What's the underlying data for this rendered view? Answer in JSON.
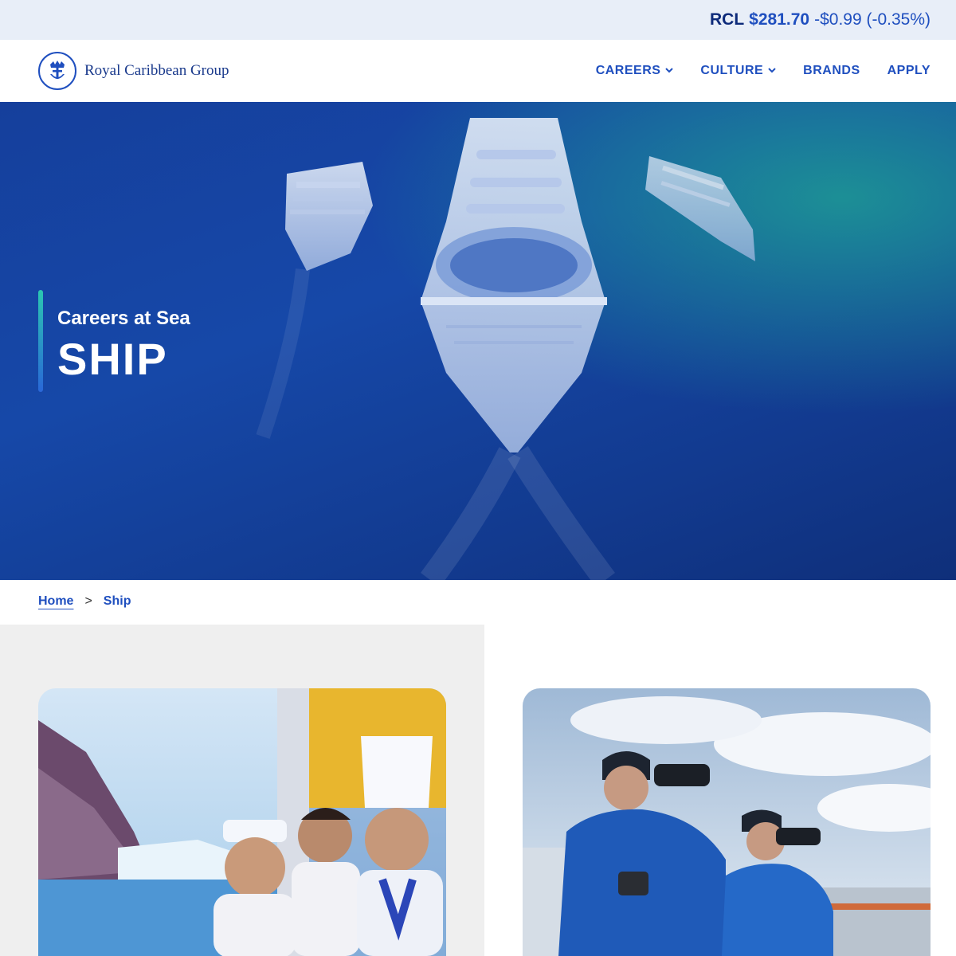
{
  "stock": {
    "symbol": "RCL",
    "price": "$281.70",
    "change": "-$0.99 (-0.35%)"
  },
  "header": {
    "logo_text": "Royal Caribbean Group"
  },
  "nav": [
    {
      "label": "CAREERS",
      "has_dropdown": true
    },
    {
      "label": "CULTURE",
      "has_dropdown": true
    },
    {
      "label": "BRANDS",
      "has_dropdown": false
    },
    {
      "label": "APPLY",
      "has_dropdown": false
    }
  ],
  "hero": {
    "subtitle": "Careers at Sea",
    "title": "SHIP"
  },
  "breadcrumb": {
    "home": "Home",
    "separator": ">",
    "current": "Ship"
  },
  "colors": {
    "brand_blue": "#1f4fbf",
    "dark_navy": "#0d2a7a",
    "stock_bar_bg": "#e8eef8",
    "panel_gray": "#efefef"
  },
  "icons": [
    "crown-anchor-logo-icon",
    "chevron-down-icon"
  ]
}
